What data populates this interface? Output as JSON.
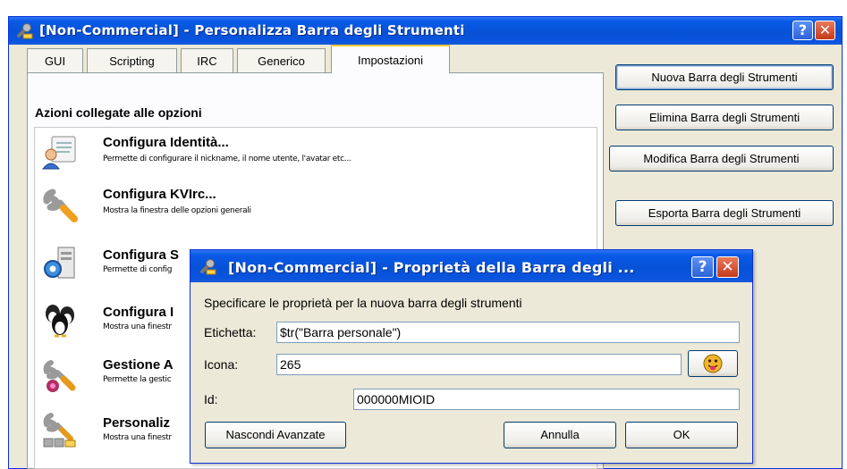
{
  "main_window": {
    "title": "[Non-Commercial] - Personalizza Barra degli Strumenti",
    "help_glyph": "?",
    "close_glyph": "✕",
    "tabs": [
      {
        "label": "GUI"
      },
      {
        "label": "Scripting"
      },
      {
        "label": "IRC"
      },
      {
        "label": "Generico"
      },
      {
        "label": "Impostazioni"
      }
    ],
    "active_tab": "Impostazioni",
    "section_label": "Azioni collegate alle opzioni",
    "actions": [
      {
        "title": "Configura Identità...",
        "desc": "Permette di configurare il nickname, il nome utente, l'avatar etc...",
        "icon": "identity-icon"
      },
      {
        "title": "Configura KVIrc...",
        "desc": "Mostra la finestra delle opzioni generali",
        "icon": "wrench-icon"
      },
      {
        "title": "Configura S",
        "desc": "Permette di config",
        "icon": "server-config-icon"
      },
      {
        "title": "Configura I",
        "desc": "Mostra una finestr",
        "icon": "users-icon"
      },
      {
        "title": "Gestione A",
        "desc": "Permette la gestic",
        "icon": "addon-manage-icon"
      },
      {
        "title": "Personaliz",
        "desc": "Mostra una finestr",
        "icon": "toolbar-customize-icon"
      }
    ],
    "buttons": {
      "new_toolbar": "Nuova Barra degli Strumenti",
      "delete_toolbar": "Elimina Barra degli Strumenti",
      "edit_toolbar": "Modifica Barra degli Strumenti",
      "export_toolbar": "Esporta Barra degli Strumenti"
    }
  },
  "dialog": {
    "title": "[Non-Commercial] - Proprietà della Barra degli ...",
    "help_glyph": "?",
    "close_glyph": "✕",
    "instruction": "Specificare le proprietà per la nuova barra degli strumenti",
    "label_field": {
      "label": "Etichetta:",
      "value": "$tr(\"Barra personale\")"
    },
    "icon_field": {
      "label": "Icona:",
      "value": "265",
      "icon": "smiley-tongue-icon"
    },
    "id_field": {
      "label": "Id:",
      "value": "000000MIOID"
    },
    "buttons": {
      "hide_advanced": "Nascondi Avanzate",
      "cancel": "Annulla",
      "ok": "OK"
    }
  },
  "colors": {
    "titlebar": "#0a5ae8",
    "window_face": "#ece9d8",
    "active_tab_highlight": "#ffc83c",
    "close_button": "#c6391a"
  }
}
